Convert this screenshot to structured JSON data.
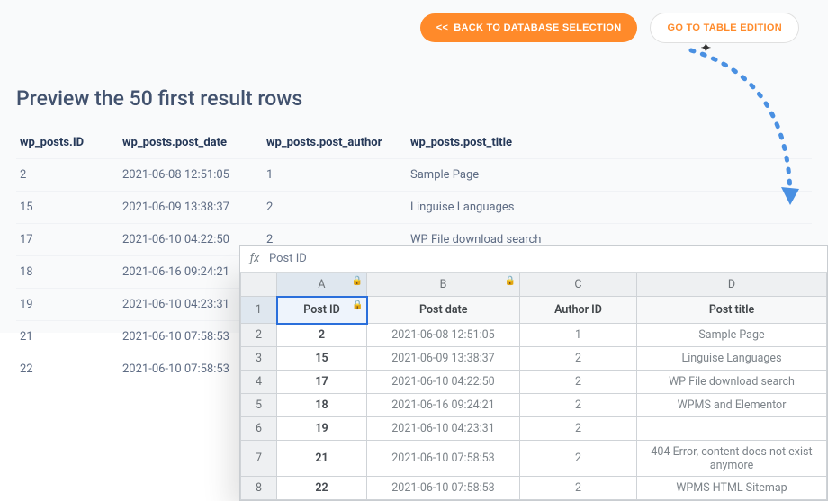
{
  "buttons": {
    "back": "BACK TO DATABASE SELECTION",
    "edit": "GO TO TABLE EDITION",
    "chev": "<<"
  },
  "title": "Preview the 50 first result rows",
  "preview": {
    "headers": [
      "wp_posts.ID",
      "wp_posts.post_date",
      "wp_posts.post_author",
      "wp_posts.post_title"
    ],
    "rows": [
      [
        "2",
        "2021-06-08 12:51:05",
        "1",
        "Sample Page"
      ],
      [
        "15",
        "2021-06-09 13:38:37",
        "2",
        "Linguise Languages"
      ],
      [
        "17",
        "2021-06-10 04:22:50",
        "2",
        "WP File download search"
      ],
      [
        "18",
        "2021-06-16 09:24:21",
        "2",
        "WPMS and Elementor"
      ],
      [
        "19",
        "2021-06-10 04:23:31",
        "",
        ""
      ],
      [
        "21",
        "2021-06-10 07:58:53",
        "",
        ""
      ],
      [
        "22",
        "2021-06-10 07:58:53",
        "",
        ""
      ]
    ]
  },
  "sheet": {
    "fx_label": "Post ID",
    "cols": [
      "A",
      "B",
      "C",
      "D"
    ],
    "header_row": [
      "Post ID",
      "Post date",
      "Author ID",
      "Post title"
    ],
    "rows": [
      [
        "2",
        "2021-06-08 12:51:05",
        "1",
        "Sample Page"
      ],
      [
        "15",
        "2021-06-09 13:38:37",
        "2",
        "Linguise Languages"
      ],
      [
        "17",
        "2021-06-10 04:22:50",
        "2",
        "WP File download search"
      ],
      [
        "18",
        "2021-06-16 09:24:21",
        "2",
        "WPMS and Elementor"
      ],
      [
        "19",
        "2021-06-10 04:23:31",
        "2",
        ""
      ],
      [
        "21",
        "2021-06-10 07:58:53",
        "2",
        "404 Error, content does not exist anymore"
      ],
      [
        "22",
        "2021-06-10 07:58:53",
        "2",
        "WPMS HTML Sitemap"
      ]
    ]
  }
}
